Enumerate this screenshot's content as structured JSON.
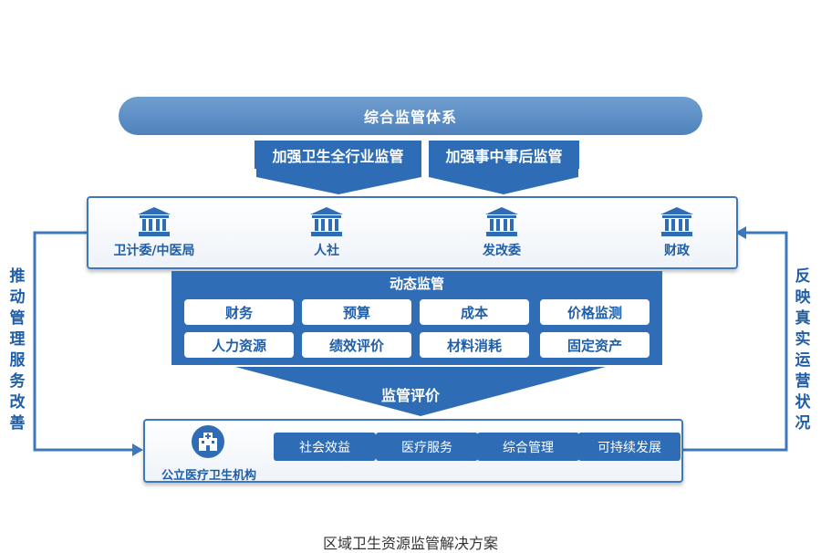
{
  "top_banner": "综合监管体系",
  "tags": [
    "加强卫生全行业监管",
    "加强事中事后监管"
  ],
  "agencies": [
    "卫计委/中医局",
    "人社",
    "发改委",
    "财政"
  ],
  "dynamic": {
    "title": "动态监管",
    "items": [
      "财务",
      "预算",
      "成本",
      "价格监测",
      "人力资源",
      "绩效评价",
      "材料消耗",
      "固定资产"
    ]
  },
  "evaluation": "监管评价",
  "hospital": {
    "label": "公立医疗卫生机构",
    "items": [
      "社会效益",
      "医疗服务",
      "综合管理",
      "可持续发展"
    ]
  },
  "side_left": [
    "推",
    "动",
    "管",
    "理",
    "服",
    "务",
    "改",
    "善"
  ],
  "side_right": [
    "反",
    "映",
    "真",
    "实",
    "运",
    "营",
    "状",
    "况"
  ],
  "caption": "区域卫生资源监管解决方案",
  "colors": {
    "primary": "#2e6cb5",
    "banner": "#5a8bc6",
    "text_blue": "#1f5ea8"
  }
}
